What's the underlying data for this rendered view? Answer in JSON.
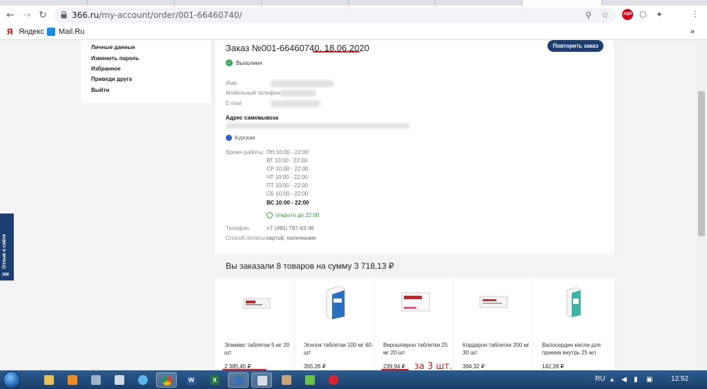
{
  "browser": {
    "url_host": "366.ru",
    "url_path": "/my-account/order/001-66460740/",
    "bookmarks": [
      {
        "label": "Яндекс"
      },
      {
        "label": "Mail.Ru"
      }
    ],
    "ext_abp": "ABP",
    "bookmarks_more": "»"
  },
  "sidebar": {
    "items": [
      {
        "label": "Личные данные"
      },
      {
        "label": "Изменить пароль"
      },
      {
        "label": "Избранное"
      },
      {
        "label": "Приведи друга"
      },
      {
        "label": "Выйти"
      }
    ]
  },
  "order": {
    "title": "Заказ №001-66460740, 18.06.2020",
    "repeat_button": "Повторить заказ",
    "status": "Выполнен",
    "labels": {
      "name": "Имя:",
      "phone": "Мобильный телефон:",
      "email": "E-mail"
    },
    "pickup_address_label": "Адрес самовывоза",
    "metro": "Курская",
    "hours_label": "Время работы:",
    "hours": [
      "ПН 10:00 - 22:00",
      "ВТ 10:00 - 22:00",
      "СР 10:00 - 22:00",
      "ЧТ 10:00 - 22:00",
      "ПТ 10:00 - 22:00",
      "СБ 10:00 - 22:00",
      "ВС 10:00 - 22:00"
    ],
    "open_now": "открыто до 22:00",
    "phone_label": "Телефон:",
    "phone": "+7 (495) 797-63-36",
    "payment_label": "Способ оплаты:",
    "payment": "картой, наличными"
  },
  "summary": "Вы заказали 8 товаров на сумму 3 718,13 ₽",
  "products": [
    {
      "name": "Эликвис таблетки 5 мг 20 шт",
      "price": "2 385,45 ₽"
    },
    {
      "name": "Эгилок таблетки 100 мг 60 шт",
      "price": "355,26 ₽"
    },
    {
      "name": "Верошпирон таблетки 25 мг 20 шт",
      "price": "239,94 ₽"
    },
    {
      "name": "Кордарон таблетки 200 мг 30 шт",
      "price": "394,32 ₽"
    },
    {
      "name": "Валосердин капли для приема внутрь 25 мл",
      "price": "142,28 ₽"
    }
  ],
  "annotation": "за 3 шт.",
  "feedback_tab": {
    "label": "Отзыв о сайте",
    "badge": "366"
  },
  "taskbar": {
    "lang": "RU",
    "time": "12:52",
    "word_letter": "W",
    "excel_letter": "X"
  }
}
